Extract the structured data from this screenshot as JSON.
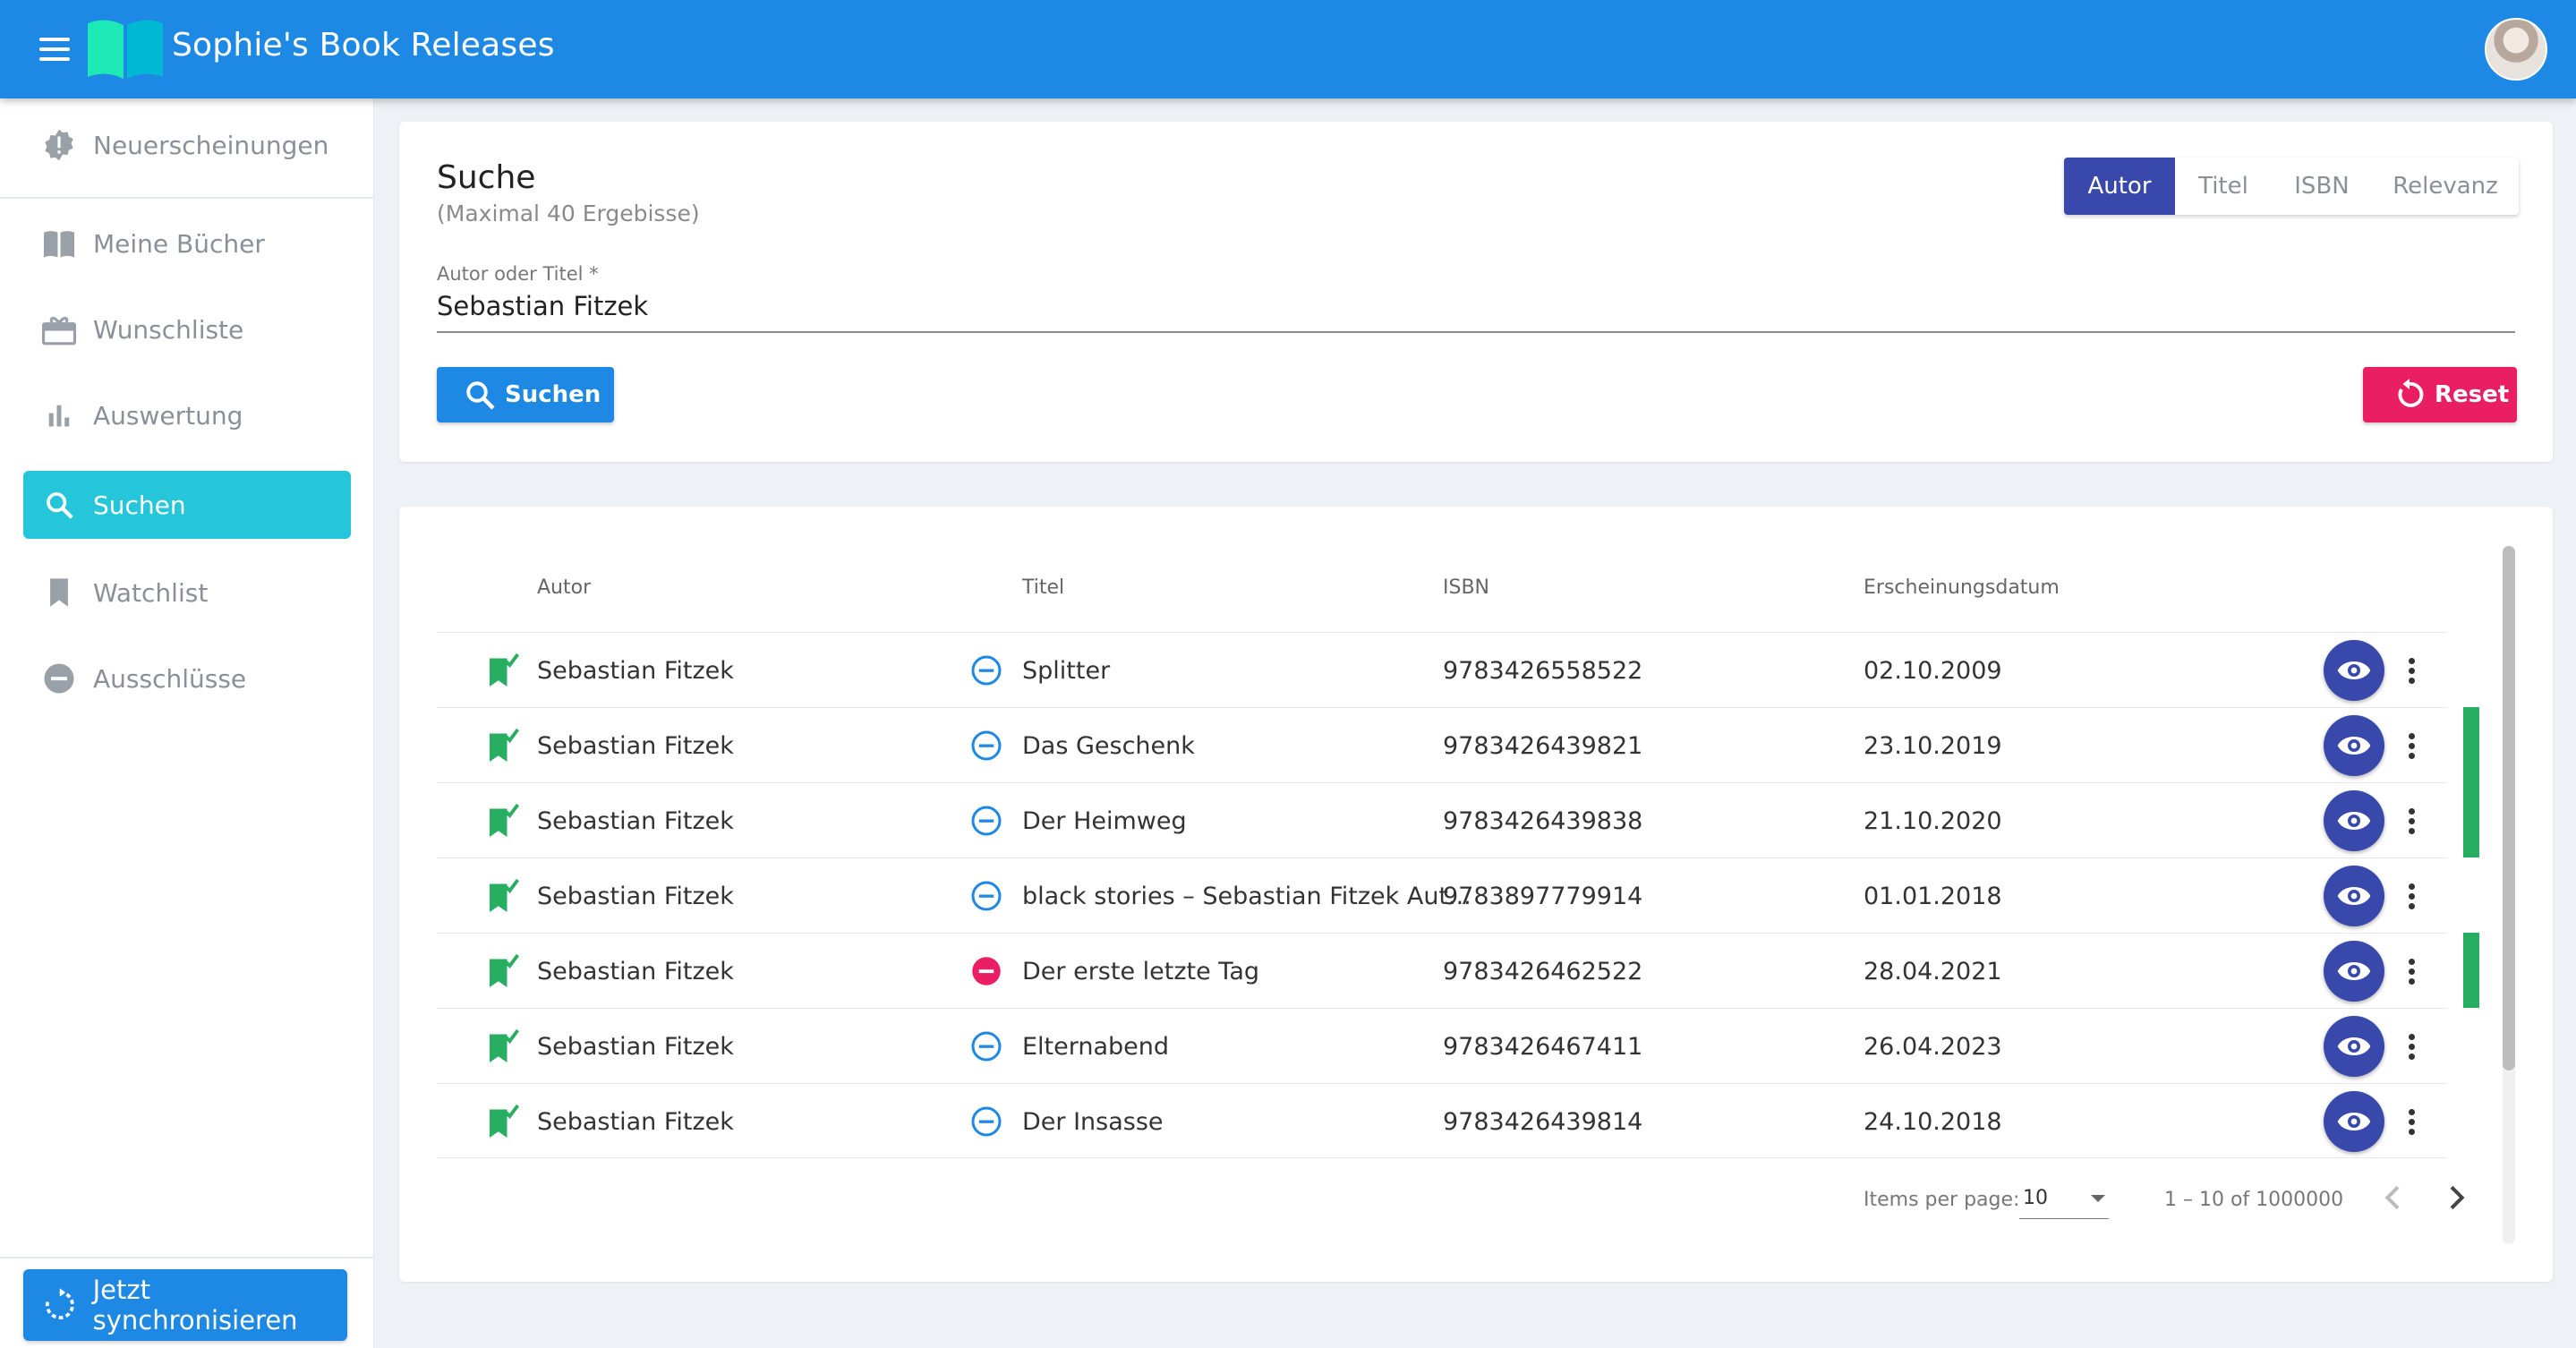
{
  "app": {
    "title": "Sophie's Book Releases"
  },
  "sidebar": {
    "items": [
      {
        "label": "Neuerscheinungen",
        "icon": "new-releases-icon"
      },
      {
        "label": "Meine Bücher",
        "icon": "book-open-icon"
      },
      {
        "label": "Wunschliste",
        "icon": "gift-icon"
      },
      {
        "label": "Auswertung",
        "icon": "bar-chart-icon"
      },
      {
        "label": "Suchen",
        "icon": "search-icon",
        "active": true
      },
      {
        "label": "Watchlist",
        "icon": "bookmark-icon"
      },
      {
        "label": "Ausschlüsse",
        "icon": "minus-circle-icon"
      }
    ],
    "sync_label": "Jetzt synchronisieren"
  },
  "search": {
    "title": "Suche",
    "subtitle": "(Maximal 40 Ergebisse)",
    "modes": [
      "Autor",
      "Titel",
      "ISBN",
      "Relevanz"
    ],
    "active_mode": "Autor",
    "field_label": "Autor oder Titel *",
    "field_value": "Sebastian Fitzek",
    "search_button": "Suchen",
    "reset_button": "Reset"
  },
  "table": {
    "columns": [
      "Autor",
      "Titel",
      "ISBN",
      "Erscheinungsdatum"
    ],
    "rows": [
      {
        "author": "Sebastian Fitzek",
        "title": "Splitter",
        "isbn": "9783426558522",
        "date": "02.10.2009",
        "status": "neutral",
        "marked": false
      },
      {
        "author": "Sebastian Fitzek",
        "title": "Das Geschenk",
        "isbn": "9783426439821",
        "date": "23.10.2019",
        "status": "neutral",
        "marked": true
      },
      {
        "author": "Sebastian Fitzek",
        "title": "Der Heimweg",
        "isbn": "9783426439838",
        "date": "21.10.2020",
        "status": "neutral",
        "marked": true
      },
      {
        "author": "Sebastian Fitzek",
        "title": "black stories – Sebastian Fitzek Aut...",
        "isbn": "9783897779914",
        "date": "01.01.2018",
        "status": "neutral",
        "marked": false
      },
      {
        "author": "Sebastian Fitzek",
        "title": "Der erste letzte Tag",
        "isbn": "9783426462522",
        "date": "28.04.2021",
        "status": "excluded",
        "marked": true
      },
      {
        "author": "Sebastian Fitzek",
        "title": "Elternabend",
        "isbn": "9783426467411",
        "date": "26.04.2023",
        "status": "neutral",
        "marked": false
      },
      {
        "author": "Sebastian Fitzek",
        "title": "Der Insasse",
        "isbn": "9783426439814",
        "date": "24.10.2018",
        "status": "neutral",
        "marked": false
      }
    ]
  },
  "pager": {
    "items_per_page_label": "Items per page:",
    "items_per_page": "10",
    "range": "1 – 10 of 1000000"
  },
  "colors": {
    "primary": "#1e88e5",
    "accent_cyan": "#26c6da",
    "indigo": "#3949ab",
    "pink": "#e91e63",
    "green": "#27ae60"
  }
}
